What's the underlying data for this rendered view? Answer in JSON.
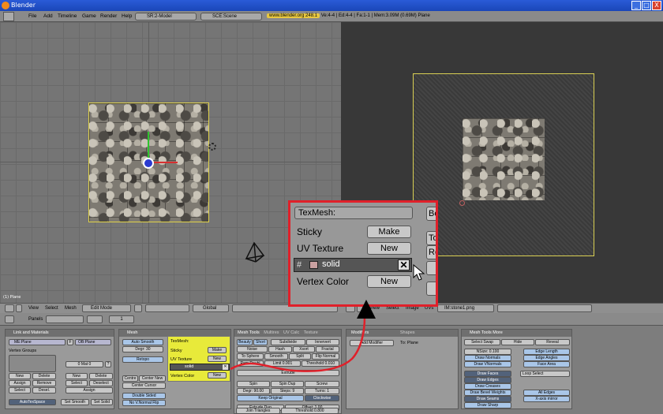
{
  "window": {
    "title": "Blender",
    "min": "_",
    "max": "□",
    "close": "X"
  },
  "menubar": {
    "items": [
      "File",
      "Add",
      "Timeline",
      "Game",
      "Render",
      "Help"
    ],
    "screen_select": "SR:2-Model",
    "scene_select": "SCE:Scene",
    "url": "www.blender.org 248.1",
    "stats": "Ve:4-4 | Ed:4-4 | Fa:1-1 | Mem:3.09M (0.69M) Plane"
  },
  "viewport3d": {
    "label": "(1) Plane"
  },
  "header3d": {
    "items": [
      "View",
      "Select",
      "Mesh"
    ],
    "mode": "Edit Mode",
    "orientation": "Global"
  },
  "headeruv": {
    "items": [
      "View",
      "Select",
      "Image",
      "UVs"
    ],
    "image": "IM:stone1.png"
  },
  "buttons_header": {
    "panels_label": "Panels",
    "frame": "1"
  },
  "panel_link": {
    "title": "Link and Materials",
    "me": "ME:Plane",
    "f": "F",
    "ob": "OB:Plane",
    "vertex_groups": "Vertex Groups",
    "mat": "0 Mat 0",
    "q": "?",
    "new": "New",
    "delete": "Delete",
    "assign": "Assign",
    "remove": "Remove",
    "select": "Select",
    "deselect": "Desel.",
    "new2": "New",
    "delete2": "Delete",
    "select2": "Select",
    "deselect2": "Deselect",
    "assign2": "Assign",
    "autotex": "AutoTexSpace",
    "set_smooth": "Set Smooth",
    "set_solid": "Set Solid"
  },
  "panel_mesh": {
    "title": "Mesh",
    "auto_smooth": "Auto Smooth",
    "degr": "Degr: 30",
    "retopo": "Retopo",
    "centre": "Centre",
    "centre_new": "Center New",
    "center_cursor": "Center Cursor",
    "double_sided": "Double Sided",
    "no_vnormal": "No V.Normal Flip"
  },
  "texmesh": {
    "title": "TexMesh:",
    "sticky": "Sticky",
    "make": "Make",
    "uv_texture": "UV Texture",
    "new": "New",
    "layer": "solid",
    "vertex_color": "Vertex Color",
    "new2": "New",
    "x": "✕"
  },
  "panel_tools": {
    "tabs": [
      "Mesh Tools",
      "Multires",
      "UV Calc",
      "Texture"
    ],
    "beauty": "Beauty",
    "short": "Short",
    "subdivide": "Subdivide",
    "innervert": "Innervert",
    "noise": "Noise",
    "hash": "Hash",
    "xsort": "Xsort",
    "fractal": "Fractal",
    "to_sphere": "To Sphere",
    "smooth": "Smooth",
    "split": "Split",
    "flip_normal": "Flip Normal",
    "rem_doubl": "Rem Doubl",
    "limit": "Limit 0.001",
    "threshold": "Threshold 0.010",
    "extrude": "Extrude",
    "spin": "Spin",
    "spin_dup": "Spin Dup",
    "screw": "Screw",
    "degr90": "Degr: 90.00",
    "steps": "Steps: 9",
    "turns": "Turns: 1",
    "keep_original": "Keep Original",
    "clockwise": "Clockwise",
    "extrude_dup": "Extrude Dup",
    "offset": "Offset: 1.00",
    "join_triangles": "Join Triangles",
    "threshold2": "Threshold 0.800"
  },
  "panel_modifiers": {
    "tabs": [
      "Modifiers",
      "Shapes"
    ],
    "add_modifier": "Add Modifier",
    "to": "To: Plane"
  },
  "panel_more": {
    "title": "Mesh Tools More",
    "select_swap": "Select Swap",
    "hide": "Hide",
    "reveal": "Reveal",
    "nsize": "NSize: 0.100",
    "edge_length": "Edge Length",
    "draw_normals": "Draw Normals",
    "edge_angles": "Edge Angles",
    "draw_vnormals": "Draw VNormals",
    "face_area": "Face Area",
    "draw_faces": "Draw Faces",
    "loop_select": "Loop Select",
    "draw_edges": "Draw Edges",
    "draw_creases": "Draw Creases",
    "draw_bevel": "Draw Bevel Weights",
    "all_edges": "All Edges",
    "draw_seams": "Draw Seams",
    "x_axis_mirror": "X-axis mirror",
    "draw_sharp": "Draw Sharp"
  },
  "zoom": {
    "title": "TexMesh:",
    "sticky": "Sticky",
    "make": "Make",
    "uv_texture": "UV Texture",
    "new": "New",
    "layer": "solid",
    "x": "✕",
    "vertex_color": "Vertex Color",
    "new2": "New",
    "side": [
      "Be",
      "To",
      "Re"
    ]
  },
  "colors": {
    "highlight": "#e8ea3a",
    "annotation": "#e0202a",
    "selection": "#e0d24a"
  }
}
